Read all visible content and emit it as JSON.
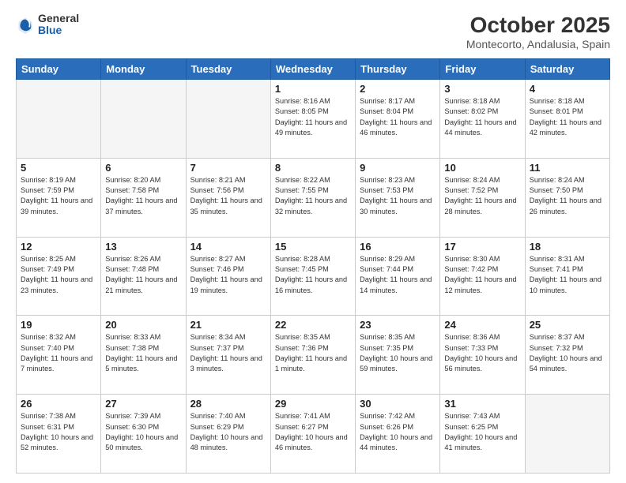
{
  "header": {
    "logo": {
      "line1": "General",
      "line2": "Blue"
    },
    "title": "October 2025",
    "subtitle": "Montecorto, Andalusia, Spain"
  },
  "days_of_week": [
    "Sunday",
    "Monday",
    "Tuesday",
    "Wednesday",
    "Thursday",
    "Friday",
    "Saturday"
  ],
  "weeks": [
    [
      {
        "num": "",
        "info": ""
      },
      {
        "num": "",
        "info": ""
      },
      {
        "num": "",
        "info": ""
      },
      {
        "num": "1",
        "info": "Sunrise: 8:16 AM\nSunset: 8:05 PM\nDaylight: 11 hours\nand 49 minutes."
      },
      {
        "num": "2",
        "info": "Sunrise: 8:17 AM\nSunset: 8:04 PM\nDaylight: 11 hours\nand 46 minutes."
      },
      {
        "num": "3",
        "info": "Sunrise: 8:18 AM\nSunset: 8:02 PM\nDaylight: 11 hours\nand 44 minutes."
      },
      {
        "num": "4",
        "info": "Sunrise: 8:18 AM\nSunset: 8:01 PM\nDaylight: 11 hours\nand 42 minutes."
      }
    ],
    [
      {
        "num": "5",
        "info": "Sunrise: 8:19 AM\nSunset: 7:59 PM\nDaylight: 11 hours\nand 39 minutes."
      },
      {
        "num": "6",
        "info": "Sunrise: 8:20 AM\nSunset: 7:58 PM\nDaylight: 11 hours\nand 37 minutes."
      },
      {
        "num": "7",
        "info": "Sunrise: 8:21 AM\nSunset: 7:56 PM\nDaylight: 11 hours\nand 35 minutes."
      },
      {
        "num": "8",
        "info": "Sunrise: 8:22 AM\nSunset: 7:55 PM\nDaylight: 11 hours\nand 32 minutes."
      },
      {
        "num": "9",
        "info": "Sunrise: 8:23 AM\nSunset: 7:53 PM\nDaylight: 11 hours\nand 30 minutes."
      },
      {
        "num": "10",
        "info": "Sunrise: 8:24 AM\nSunset: 7:52 PM\nDaylight: 11 hours\nand 28 minutes."
      },
      {
        "num": "11",
        "info": "Sunrise: 8:24 AM\nSunset: 7:50 PM\nDaylight: 11 hours\nand 26 minutes."
      }
    ],
    [
      {
        "num": "12",
        "info": "Sunrise: 8:25 AM\nSunset: 7:49 PM\nDaylight: 11 hours\nand 23 minutes."
      },
      {
        "num": "13",
        "info": "Sunrise: 8:26 AM\nSunset: 7:48 PM\nDaylight: 11 hours\nand 21 minutes."
      },
      {
        "num": "14",
        "info": "Sunrise: 8:27 AM\nSunset: 7:46 PM\nDaylight: 11 hours\nand 19 minutes."
      },
      {
        "num": "15",
        "info": "Sunrise: 8:28 AM\nSunset: 7:45 PM\nDaylight: 11 hours\nand 16 minutes."
      },
      {
        "num": "16",
        "info": "Sunrise: 8:29 AM\nSunset: 7:44 PM\nDaylight: 11 hours\nand 14 minutes."
      },
      {
        "num": "17",
        "info": "Sunrise: 8:30 AM\nSunset: 7:42 PM\nDaylight: 11 hours\nand 12 minutes."
      },
      {
        "num": "18",
        "info": "Sunrise: 8:31 AM\nSunset: 7:41 PM\nDaylight: 11 hours\nand 10 minutes."
      }
    ],
    [
      {
        "num": "19",
        "info": "Sunrise: 8:32 AM\nSunset: 7:40 PM\nDaylight: 11 hours\nand 7 minutes."
      },
      {
        "num": "20",
        "info": "Sunrise: 8:33 AM\nSunset: 7:38 PM\nDaylight: 11 hours\nand 5 minutes."
      },
      {
        "num": "21",
        "info": "Sunrise: 8:34 AM\nSunset: 7:37 PM\nDaylight: 11 hours\nand 3 minutes."
      },
      {
        "num": "22",
        "info": "Sunrise: 8:35 AM\nSunset: 7:36 PM\nDaylight: 11 hours\nand 1 minute."
      },
      {
        "num": "23",
        "info": "Sunrise: 8:35 AM\nSunset: 7:35 PM\nDaylight: 10 hours\nand 59 minutes."
      },
      {
        "num": "24",
        "info": "Sunrise: 8:36 AM\nSunset: 7:33 PM\nDaylight: 10 hours\nand 56 minutes."
      },
      {
        "num": "25",
        "info": "Sunrise: 8:37 AM\nSunset: 7:32 PM\nDaylight: 10 hours\nand 54 minutes."
      }
    ],
    [
      {
        "num": "26",
        "info": "Sunrise: 7:38 AM\nSunset: 6:31 PM\nDaylight: 10 hours\nand 52 minutes."
      },
      {
        "num": "27",
        "info": "Sunrise: 7:39 AM\nSunset: 6:30 PM\nDaylight: 10 hours\nand 50 minutes."
      },
      {
        "num": "28",
        "info": "Sunrise: 7:40 AM\nSunset: 6:29 PM\nDaylight: 10 hours\nand 48 minutes."
      },
      {
        "num": "29",
        "info": "Sunrise: 7:41 AM\nSunset: 6:27 PM\nDaylight: 10 hours\nand 46 minutes."
      },
      {
        "num": "30",
        "info": "Sunrise: 7:42 AM\nSunset: 6:26 PM\nDaylight: 10 hours\nand 44 minutes."
      },
      {
        "num": "31",
        "info": "Sunrise: 7:43 AM\nSunset: 6:25 PM\nDaylight: 10 hours\nand 41 minutes."
      },
      {
        "num": "",
        "info": ""
      }
    ]
  ]
}
